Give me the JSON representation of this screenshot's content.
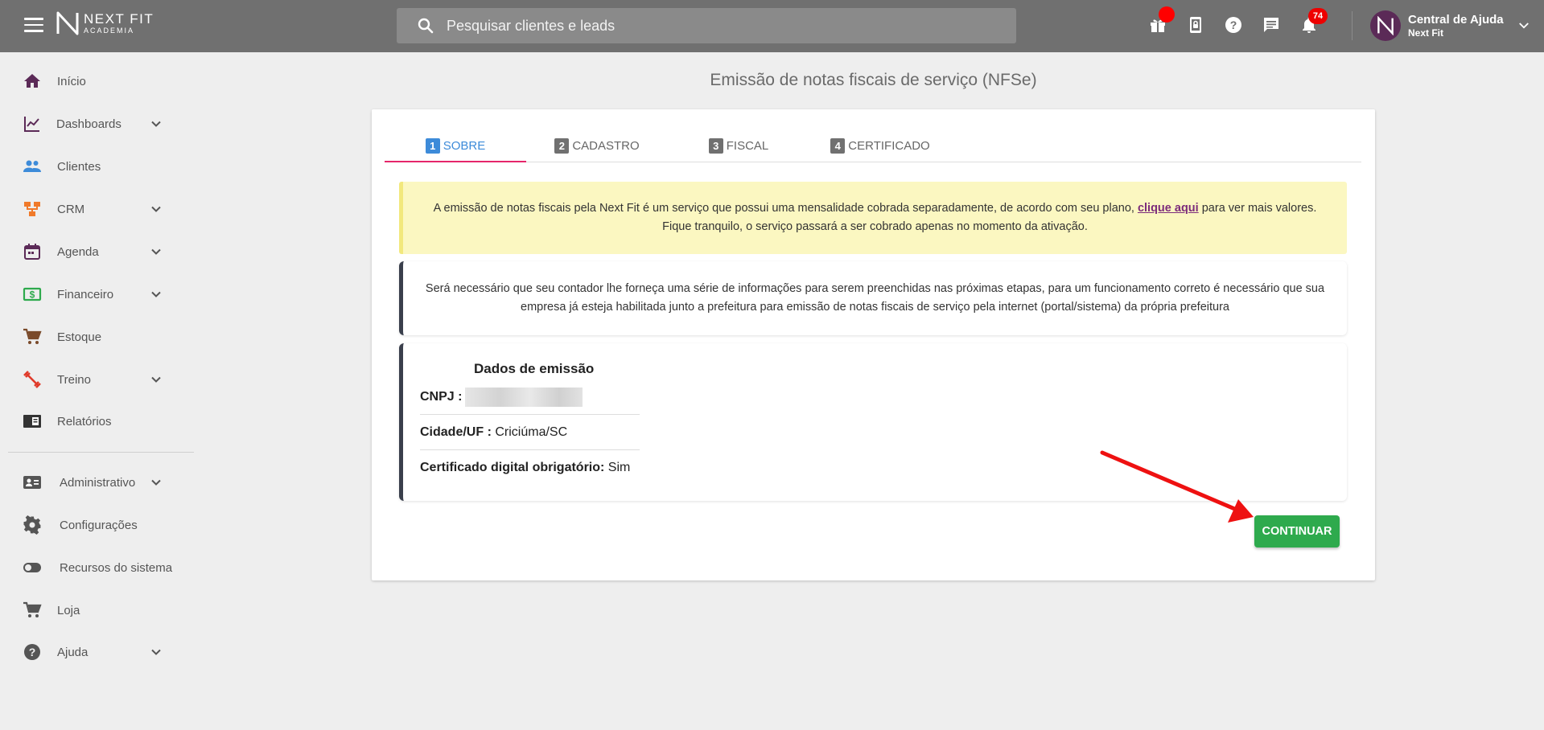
{
  "topbar": {
    "logo": {
      "name": "NEXT FIT",
      "sub": "ACADEMIA"
    },
    "search_placeholder": "Pesquisar clientes e leads",
    "notifications_count": "74",
    "user": {
      "name": "Central de Ajuda",
      "sub": "Next Fit",
      "avatar_letter": "N"
    }
  },
  "sidebar": {
    "items": [
      {
        "label": "Início",
        "icon": "home-icon",
        "color": "#5b2a57"
      },
      {
        "label": "Dashboards",
        "icon": "chart-line-icon",
        "color": "#5b2a57"
      },
      {
        "label": "Clientes",
        "icon": "people-icon",
        "color": "#3d8bd9"
      },
      {
        "label": "CRM",
        "icon": "crm-icon",
        "color": "#f07a2a"
      },
      {
        "label": "Agenda",
        "icon": "calendar-icon",
        "color": "#5b2a57"
      },
      {
        "label": "Financeiro",
        "icon": "money-icon",
        "color": "#2eaa4d"
      },
      {
        "label": "Estoque",
        "icon": "cart-icon",
        "color": "#7a4a2a"
      },
      {
        "label": "Treino",
        "icon": "dumbbell-icon",
        "color": "#e03a2a"
      },
      {
        "label": "Relatórios",
        "icon": "report-icon",
        "color": "#333333"
      },
      {
        "label": "Administrativo",
        "icon": "id-card-icon",
        "color": "#555555"
      },
      {
        "label": "Configurações",
        "icon": "gear-icon",
        "color": "#555555"
      },
      {
        "label": "Recursos do sistema",
        "icon": "toggle-icon",
        "color": "#555555"
      },
      {
        "label": "Loja",
        "icon": "cart-icon",
        "color": "#555555"
      },
      {
        "label": "Ajuda",
        "icon": "help-icon",
        "color": "#555555"
      }
    ]
  },
  "main": {
    "title": "Emissão de notas fiscais de serviço (NFSe)",
    "tabs": [
      {
        "num": "1",
        "label": "SOBRE"
      },
      {
        "num": "2",
        "label": "CADASTRO"
      },
      {
        "num": "3",
        "label": "FISCAL"
      },
      {
        "num": "4",
        "label": "CERTIFICADO"
      }
    ],
    "alert": {
      "text_before": "A emissão de notas fiscais pela Next Fit é um serviço que possui uma mensalidade cobrada separadamente, de acordo com seu plano, ",
      "link": "clique aqui",
      "text_after": " para ver mais valores. Fique tranquilo, o serviço passará a ser cobrado apenas no momento da ativação."
    },
    "info": "Será necessário que seu contador lhe forneça uma série de informações para serem preenchidas nas próximas etapas, para um funcionamento correto é necessário que sua empresa já esteja habilitada junto a prefeitura para emissão de notas fiscais de serviço pela internet (portal/sistema) da própria prefeitura",
    "data": {
      "title": "Dados de emissão",
      "cnpj_label": "CNPJ :",
      "cidade_label": "Cidade/UF :",
      "cidade_value": "Criciúma/SC",
      "cert_label": "Certificado digital obrigatório:",
      "cert_value": "Sim"
    },
    "continue_button": "CONTINUAR"
  },
  "colors": {
    "active_tab": "#3d8bd9",
    "tab_underline": "#e5266a",
    "button": "#2eaa4d",
    "alert_bg": "#fbf7c1",
    "arrow": "#ee1111"
  }
}
